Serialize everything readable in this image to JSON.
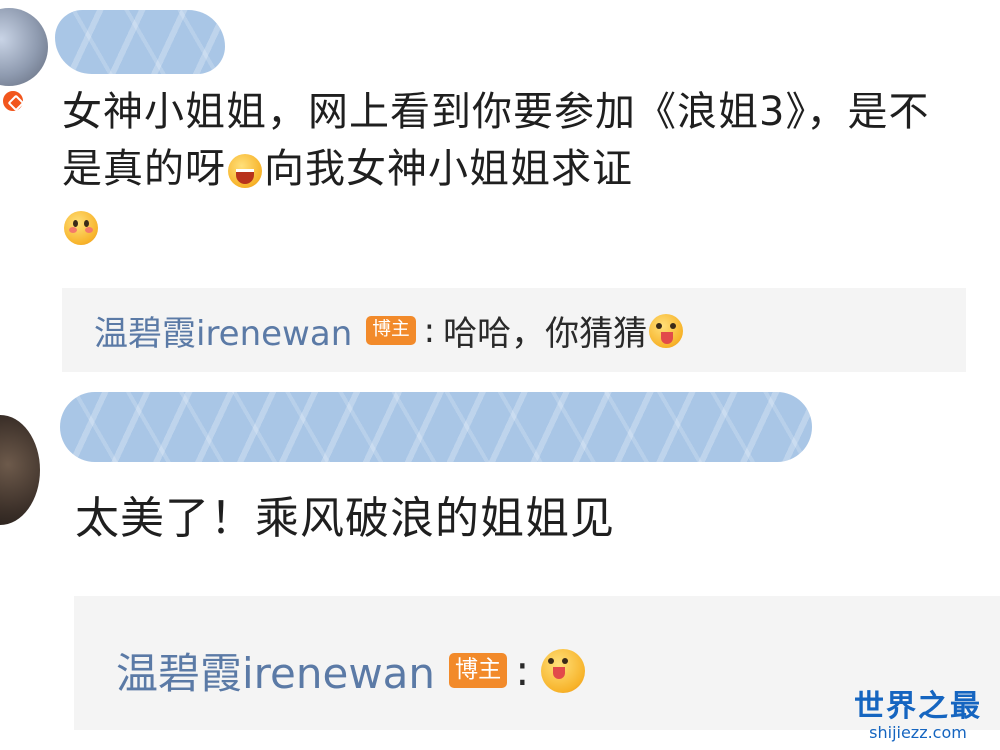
{
  "comment1": {
    "text_part1": "女神小姐姐，网上看到你要参加《浪姐3》，是不是真的呀",
    "emoji_a": "grin-emoji",
    "text_part2": "向我女神小姐姐求证",
    "emoji_b": "shy-emoji",
    "reply": {
      "author": "温碧霞irenewan",
      "badge": "博主",
      "separator": ":",
      "text": "哈哈，你猜猜",
      "emoji": "tongue-emoji"
    }
  },
  "comment2": {
    "text": "太美了！乘风破浪的姐姐见",
    "reply": {
      "author": "温碧霞irenewan",
      "badge": "博主",
      "separator": ":",
      "emoji": "tongue-emoji"
    }
  },
  "watermark": {
    "main": "世界之最",
    "url": "shijiezz.com"
  },
  "colors": {
    "author": "#5b7aa6",
    "badge": "#f28a2a",
    "reply_bg": "#f4f4f4",
    "censor": "#a9c6e6",
    "watermark": "#1565c0"
  }
}
